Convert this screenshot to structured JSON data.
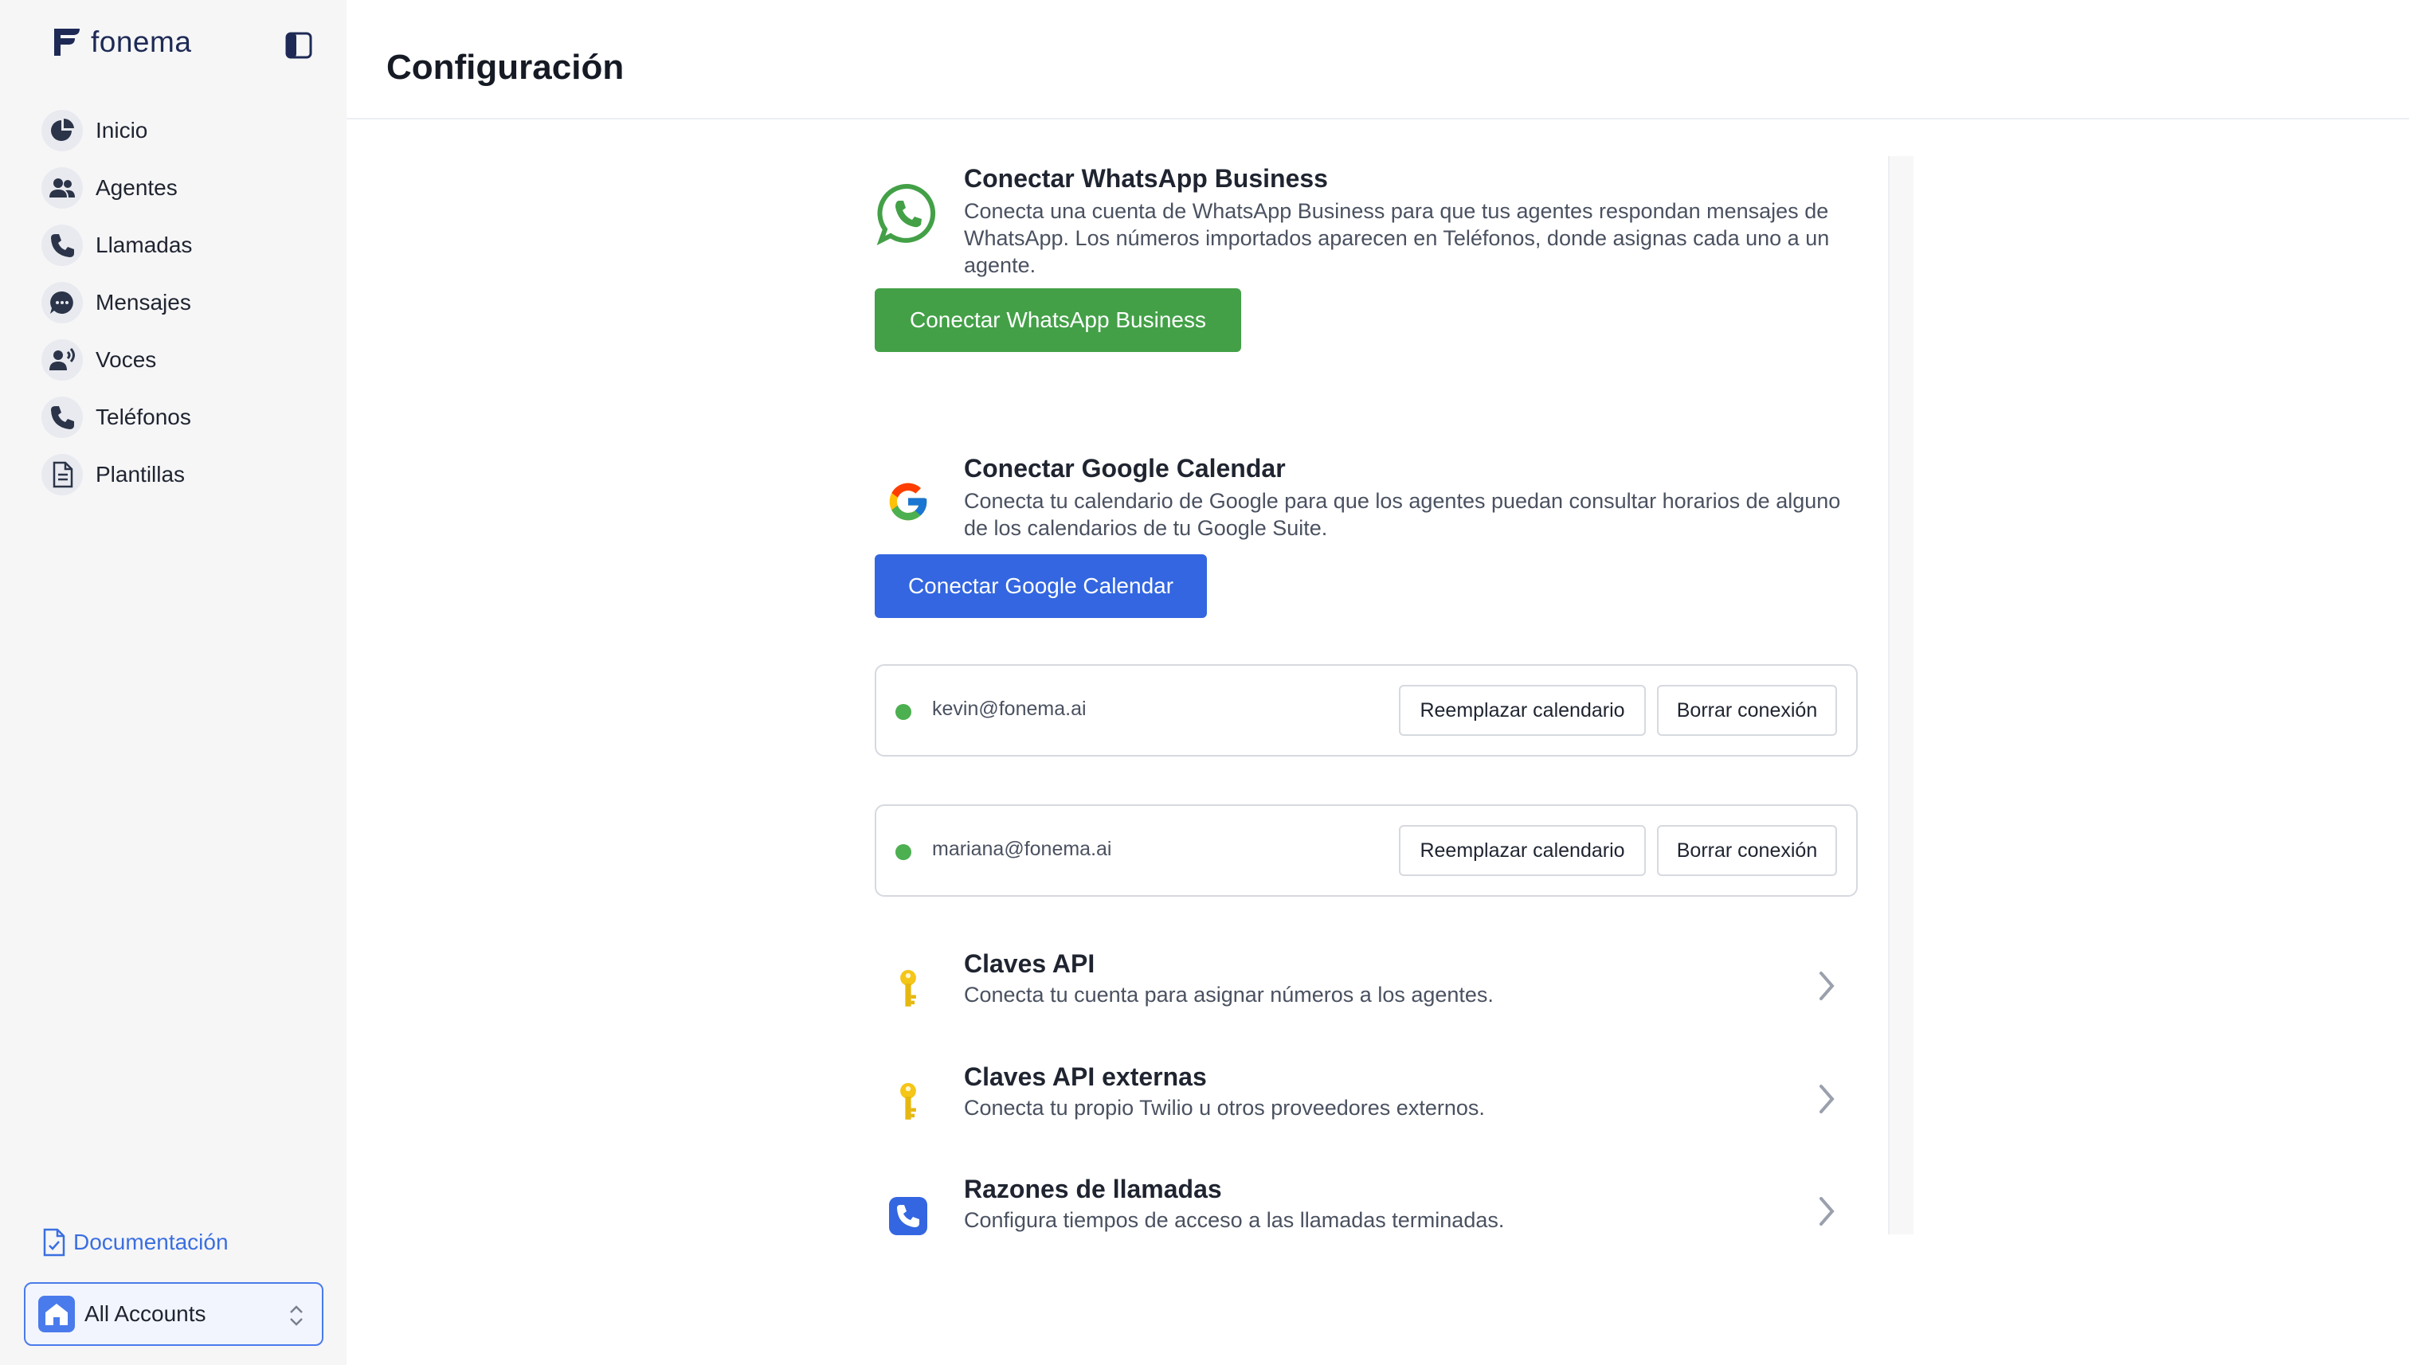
{
  "app": {
    "brand": "fonema",
    "accent": "#3366e0",
    "whatsapp_green": "#43a047"
  },
  "sidebar": {
    "items": [
      {
        "label": "Inicio",
        "icon": "pie-chart-icon"
      },
      {
        "label": "Agentes",
        "icon": "users-icon"
      },
      {
        "label": "Llamadas",
        "icon": "phone-icon"
      },
      {
        "label": "Mensajes",
        "icon": "chat-bubble-icon"
      },
      {
        "label": "Voces",
        "icon": "voice-icon"
      },
      {
        "label": "Teléfonos",
        "icon": "phone-icon"
      },
      {
        "label": "Plantillas",
        "icon": "document-icon"
      }
    ],
    "documentation": "Documentación",
    "account": "All Accounts"
  },
  "header": {
    "title": "Configuración"
  },
  "whatsapp": {
    "title": "Conectar WhatsApp Business",
    "description": "Conecta una cuenta de WhatsApp Business para que tus agentes respondan mensajes de WhatsApp. Los números importados aparecen en Teléfonos, donde asignas cada uno a un agente.",
    "button": "Conectar WhatsApp Business"
  },
  "google_calendar": {
    "title": "Conectar Google Calendar",
    "description": "Conecta tu calendario de Google para que los agentes puedan consultar horarios de alguno de los calendarios de tu Google Suite.",
    "button": "Conectar Google Calendar",
    "connections": [
      {
        "email": "kevin@fonema.ai",
        "status_color": "#4caf50",
        "replace": "Reemplazar calendario",
        "delete": "Borrar conexión"
      },
      {
        "email": "mariana@fonema.ai",
        "status_color": "#4caf50",
        "replace": "Reemplazar calendario",
        "delete": "Borrar conexión"
      }
    ]
  },
  "settings_links": [
    {
      "title": "Claves API",
      "description": "Conecta tu cuenta para asignar números a los agentes.",
      "icon": "key-icon"
    },
    {
      "title": "Claves API externas",
      "description": "Conecta tu propio Twilio u otros proveedores externos.",
      "icon": "key-icon"
    },
    {
      "title": "Razones de llamadas",
      "description": "Configura tiempos de acceso a las llamadas terminadas.",
      "icon": "phone-badge-icon"
    }
  ]
}
